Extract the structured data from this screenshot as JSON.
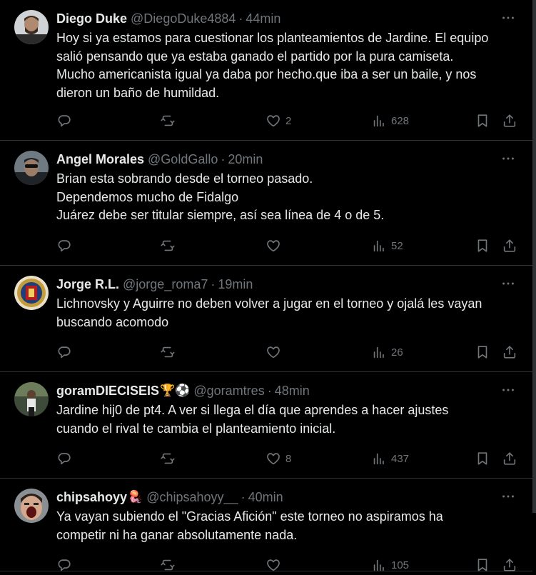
{
  "tweets": [
    {
      "name": "Diego Duke",
      "handle": "@DiegoDuke4884",
      "time": "44min",
      "text": "Hoy si ya estamos para cuestionar los planteamientos de Jardine. El equipo\nsalió pensando que ya estaba ganado el partido por la pura camiseta.\nMucho americanista igual ya daba por hecho.que iba a ser un baile, y nos\ndieron un baño de humildad.",
      "replies": "",
      "retweets": "",
      "likes": "2",
      "views": "628"
    },
    {
      "name": "Angel Morales",
      "handle": "@GoldGallo",
      "time": "20min",
      "text": "Brian esta sobrando desde el torneo pasado.\nDependemos mucho de Fidalgo\nJuárez debe ser titular siempre, así sea línea de 4 o de 5.",
      "replies": "",
      "retweets": "",
      "likes": "",
      "views": "52"
    },
    {
      "name": "Jorge R.L.",
      "handle": "@jorge_roma7",
      "time": "19min",
      "text": "Lichnovsky y Aguirre no deben volver a jugar en el torneo y ojalá les vayan\nbuscando acomodo",
      "replies": "",
      "retweets": "",
      "likes": "",
      "views": "26"
    },
    {
      "name": "goramDIECISEIS",
      "name_emoji": "🏆⚽",
      "handle": "@goramtres",
      "time": "48min",
      "text": "Jardine hij0 de pt4. A ver si llega el día que aprendes a hacer ajustes\ncuando el rival te cambia el planteamiento inicial.",
      "replies": "",
      "retweets": "",
      "likes": "8",
      "views": "437"
    },
    {
      "name": "chipsahoyy",
      "name_emoji": "🪼",
      "handle": "@chipsahoyy__",
      "time": "40min",
      "text": "Ya vayan subiendo el \"Gracias Afición\" este torneo no aspiramos ha\ncompetir ni ha ganar absolutamente nada.",
      "replies": "",
      "retweets": "",
      "likes": "",
      "views": "105"
    }
  ],
  "separator": "·",
  "more_glyph": "···",
  "colors": {
    "background": "#000000",
    "text": "#e7e9ea",
    "muted": "#71767b",
    "border": "#2f3336"
  },
  "icons": [
    "reply-icon",
    "retweet-icon",
    "like-icon",
    "views-icon",
    "bookmark-icon",
    "share-icon"
  ]
}
